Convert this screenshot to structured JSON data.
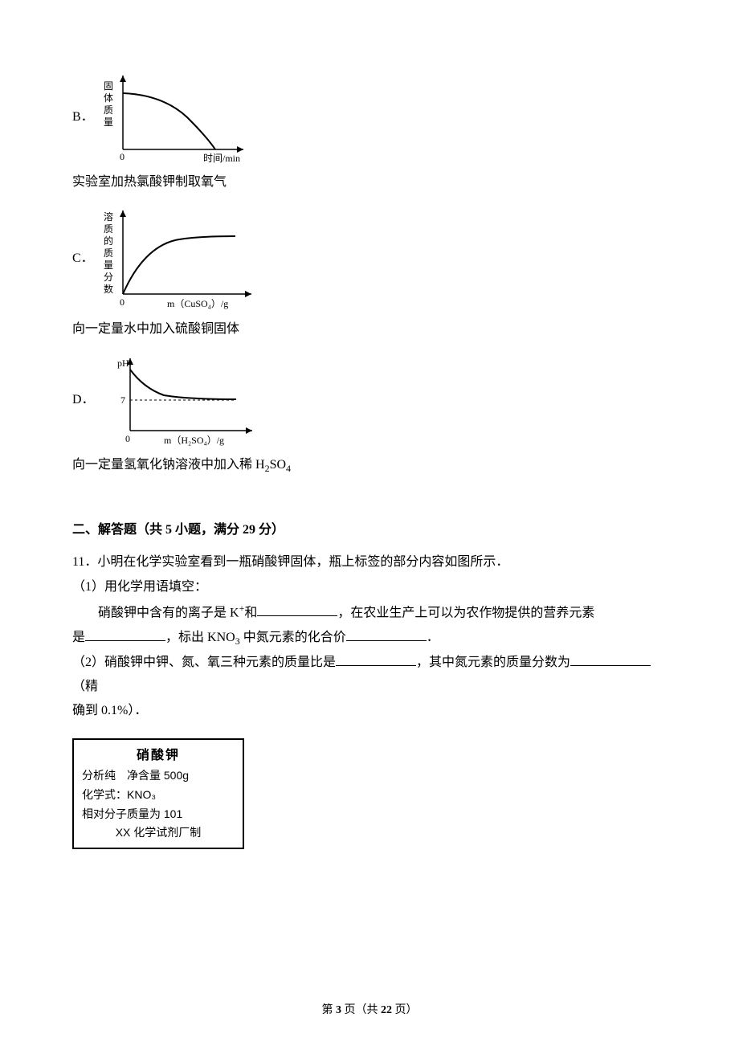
{
  "options": {
    "B": {
      "letter": "B．",
      "ylabel": "固体质量",
      "xlabel": "时间/min",
      "desc": "实验室加热氯酸钾制取氧气"
    },
    "C": {
      "letter": "C．",
      "ylabel": "溶质的质量分数",
      "xlabel": "m（CuSO₄）/g",
      "desc": "向一定量水中加入硫酸铜固体"
    },
    "D": {
      "letter": "D．",
      "ylabel": "pH",
      "ytick": "7",
      "xlabel": "m（H₂SO₄）/g",
      "desc_pre": "向一定量氢氧化钠溶液中加入稀 H",
      "desc_sub1": "2",
      "desc_mid": "SO",
      "desc_sub2": "4"
    }
  },
  "section2": {
    "title": "二、解答题（共 5 小题，满分 29 分）",
    "q11": {
      "stem": "11．小明在化学实验室看到一瓶硝酸钾固体，瓶上标签的部分内容如图所示．",
      "p1_label": "（1）用化学用语填空：",
      "p1_line1_a": "硝酸钾中含有的离子是 K",
      "p1_line1_b": "和",
      "p1_line1_c": "，在农业生产上可以为农作物提供的营养元素",
      "p1_line2_a": "是",
      "p1_line2_b": "，标出 KNO",
      "p1_line2_sub": "3",
      "p1_line2_c": " 中氮元素的化合价",
      "p1_line2_d": "．",
      "p2_a": "（2）硝酸钾中钾、氮、氧三种元素的质量比是",
      "p2_b": "，其中氮元素的质量分数为",
      "p2_c": "（精",
      "p2_d": "确到 0.1%）．"
    },
    "labelbox": {
      "title": "硝酸钾",
      "l1": "分析纯　净含量 500g",
      "l2": "化学式：KNO₃",
      "l3": "相对分子质量为 101",
      "l4": "XX 化学试剂厂制"
    }
  },
  "footer": {
    "a": "第 ",
    "pg": "3",
    "b": " 页（共 ",
    "total": "22",
    "c": " 页）"
  }
}
